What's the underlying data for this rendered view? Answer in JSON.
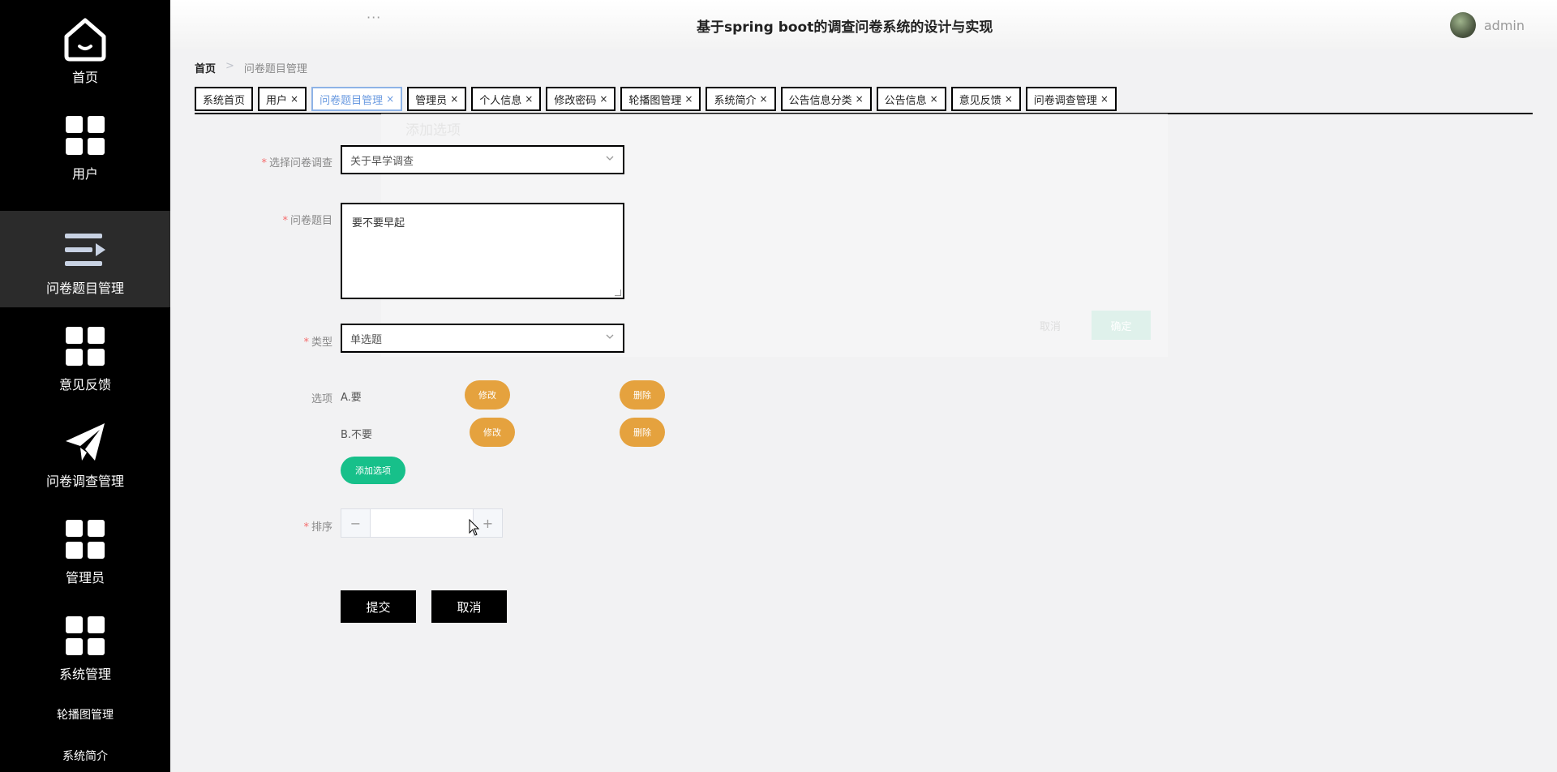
{
  "header": {
    "menu_dots": "···",
    "title": "基于spring boot的调查问卷系统的设计与实现",
    "username": "admin"
  },
  "sidebar": {
    "items": [
      {
        "label": "首页",
        "icon": "home-icon"
      },
      {
        "label": "用户",
        "icon": "grid-icon"
      },
      {
        "label": "问卷题目管理",
        "icon": "list-arrow-icon"
      },
      {
        "label": "意见反馈",
        "icon": "grid-icon"
      },
      {
        "label": "问卷调查管理",
        "icon": "paper-plane-icon"
      },
      {
        "label": "管理员",
        "icon": "grid-icon"
      },
      {
        "label": "系统管理",
        "icon": "grid-icon"
      }
    ],
    "sub_items": [
      "轮播图管理",
      "系统简介"
    ],
    "active_index": 2
  },
  "breadcrumb": {
    "home": "首页",
    "separator": ">",
    "current": "问卷题目管理"
  },
  "tabs": [
    {
      "label": "系统首页",
      "closable": false
    },
    {
      "label": "用户",
      "closable": true
    },
    {
      "label": "问卷题目管理",
      "closable": true,
      "active": true
    },
    {
      "label": "管理员",
      "closable": true
    },
    {
      "label": "个人信息",
      "closable": true
    },
    {
      "label": "修改密码",
      "closable": true
    },
    {
      "label": "轮播图管理",
      "closable": true
    },
    {
      "label": "系统简介",
      "closable": true
    },
    {
      "label": "公告信息分类",
      "closable": true
    },
    {
      "label": "公告信息",
      "closable": true
    },
    {
      "label": "意见反馈",
      "closable": true
    },
    {
      "label": "问卷调查管理",
      "closable": true
    }
  ],
  "tab_close": "×",
  "ghost_dialog": {
    "title": "添加选项",
    "cancel": "取消",
    "confirm": "确定"
  },
  "form": {
    "survey": {
      "label": "选择问卷调查",
      "value": "关于早学调查"
    },
    "question": {
      "label": "问卷题目",
      "value": "要不要早起"
    },
    "type": {
      "label": "类型",
      "value": "单选题"
    },
    "options": {
      "label": "选项",
      "items": [
        {
          "text": "A.要",
          "edit": "修改",
          "delete": "删除"
        },
        {
          "text": "B.不要",
          "edit": "修改",
          "delete": "删除"
        }
      ],
      "add_label": "添加选项"
    },
    "sort": {
      "label": "排序",
      "value": "",
      "minus": "−",
      "plus": "+"
    },
    "required_mark": "*",
    "submit": "提交",
    "cancel": "取消"
  },
  "colors": {
    "sidebar_bg": "#000000",
    "sidebar_active": "#2b2b2b",
    "option_button": "#e5a23e",
    "add_button": "#17c08a",
    "active_tab_text": "#6a9ae0",
    "required": "#f56c6c"
  }
}
